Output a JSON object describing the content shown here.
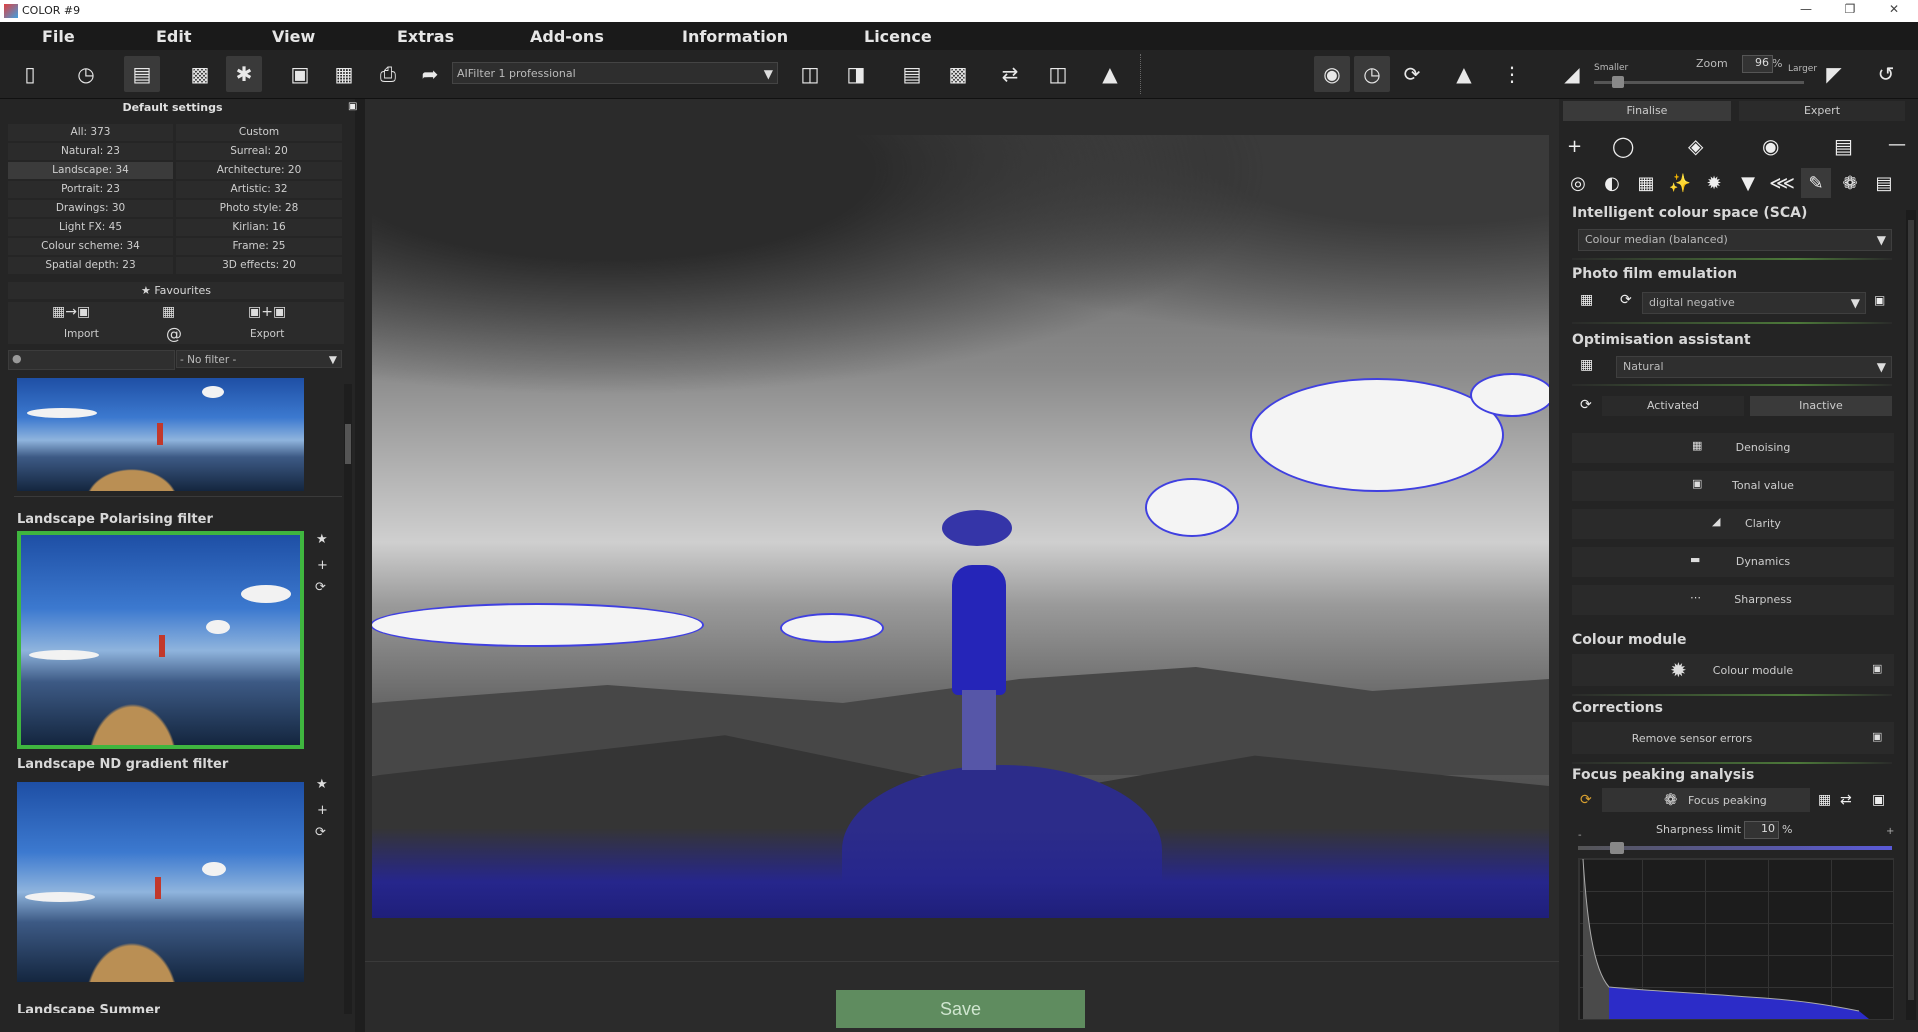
{
  "window": {
    "title": "COLOR #9"
  },
  "menu": [
    "File",
    "Edit",
    "View",
    "Extras",
    "Add-ons",
    "Information",
    "Licence"
  ],
  "toolbar": {
    "filter_name": "AIFilter 1 professional",
    "zoom_label": "Zoom",
    "zoom_value": "96",
    "zoom_unit": "%",
    "smaller_label": "Smaller",
    "larger_label": "Larger"
  },
  "left_panel": {
    "title": "Default settings",
    "categories": [
      [
        "All: 373",
        "Custom"
      ],
      [
        "Natural: 23",
        "Surreal: 20"
      ],
      [
        "Landscape: 34",
        "Architecture: 20"
      ],
      [
        "Portrait: 23",
        "Artistic: 32"
      ],
      [
        "Drawings: 30",
        "Photo style: 28"
      ],
      [
        "Light FX: 45",
        "Kirlian: 16"
      ],
      [
        "Colour scheme: 34",
        "Frame: 25"
      ],
      [
        "Spatial depth: 23",
        "3D effects: 20"
      ]
    ],
    "selected_category": "Landscape: 34",
    "favourites_label": "Favourites",
    "import_label": "Import",
    "export_label": "Export",
    "search_placeholder": "",
    "filter_select": "- No filter -",
    "thumbnails": [
      {
        "label": ""
      },
      {
        "label": "Landscape Polarising filter",
        "selected": true
      },
      {
        "label": "Landscape ND gradient filter"
      },
      {
        "label": "Landscape Summer"
      }
    ]
  },
  "center": {
    "save_label": "Save"
  },
  "right_panel": {
    "tabs": [
      "Finalise",
      "Expert"
    ],
    "sca": {
      "title": "Intelligent colour space (SCA)",
      "value": "Colour median (balanced)"
    },
    "film": {
      "title": "Photo film emulation",
      "value": "digital negative"
    },
    "optim": {
      "title": "Optimisation assistant",
      "value": "Natural",
      "activated": "Activated",
      "inactive": "Inactive",
      "items": [
        "Denoising",
        "Tonal value",
        "Clarity",
        "Dynamics",
        "Sharpness"
      ]
    },
    "colour_module": {
      "title": "Colour module",
      "button": "Colour module"
    },
    "corrections": {
      "title": "Corrections",
      "button": "Remove sensor errors"
    },
    "focus": {
      "title": "Focus peaking analysis",
      "button": "Focus peaking",
      "limit_label": "Sharpness limit",
      "limit_value": "10",
      "limit_unit": "%",
      "minus": "-",
      "plus": "+"
    }
  },
  "colors": {
    "accent_green": "#3fb63f",
    "peaking_blue": "#3b3bd8",
    "save_green": "#5f8c5f"
  }
}
